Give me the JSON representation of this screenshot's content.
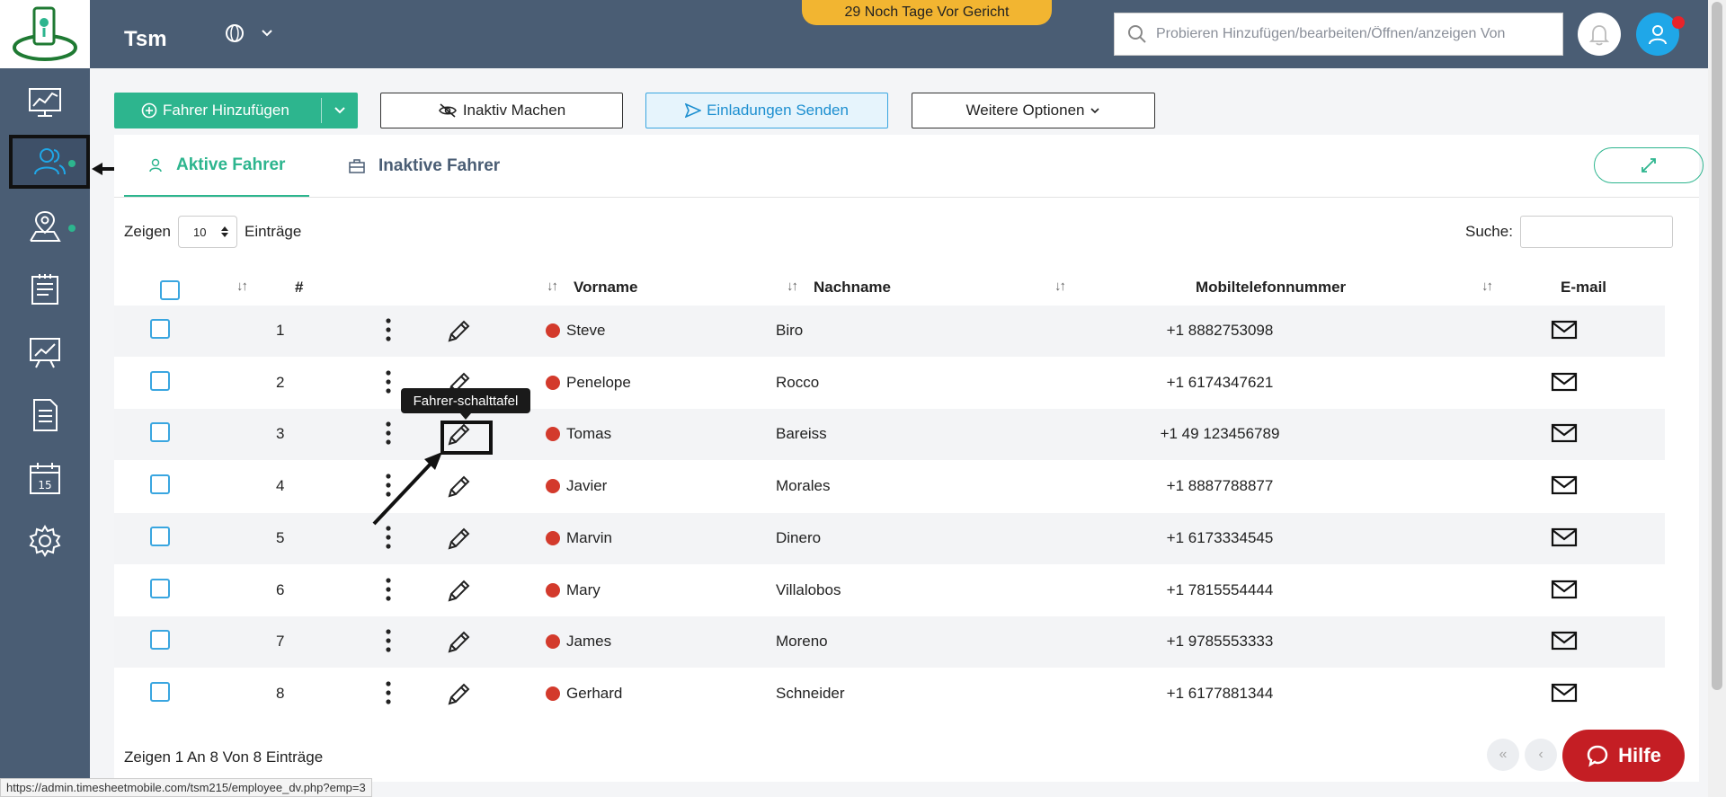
{
  "app": {
    "brand": "Tsm",
    "trial_notice": "29 Noch Tage Vor Gericht"
  },
  "header": {
    "search_placeholder": "Probieren Hinzufügen/bearbeiten/Öffnen/anzeigen Von"
  },
  "toolbar": {
    "add_driver": "Fahrer Hinzufügen",
    "deactivate": "Inaktiv Machen",
    "send_invites": "Einladungen Senden",
    "more_options": "Weitere Optionen"
  },
  "tabs": {
    "active": "Aktive Fahrer",
    "inactive": "Inaktive Fahrer"
  },
  "list_controls": {
    "show_label": "Zeigen",
    "page_size": "10",
    "entries_label": "Einträge",
    "search_label": "Suche:"
  },
  "table": {
    "headers": {
      "index": "#",
      "first_name": "Vorname",
      "last_name": "Nachname",
      "mobile": "Mobiltelefonnummer",
      "email": "E-mail"
    },
    "rows": [
      {
        "index": "1",
        "first_name": "Steve",
        "last_name": "Biro",
        "mobile": "+1 8882753098"
      },
      {
        "index": "2",
        "first_name": "Penelope",
        "last_name": "Rocco",
        "mobile": "+1 6174347621"
      },
      {
        "index": "3",
        "first_name": "Tomas",
        "last_name": "Bareiss",
        "mobile": "+1 49 123456789"
      },
      {
        "index": "4",
        "first_name": "Javier",
        "last_name": "Morales",
        "mobile": "+1 8887788877"
      },
      {
        "index": "5",
        "first_name": "Marvin",
        "last_name": "Dinero",
        "mobile": "+1 6173334545"
      },
      {
        "index": "6",
        "first_name": "Mary",
        "last_name": "Villalobos",
        "mobile": "+1 7815554444"
      },
      {
        "index": "7",
        "first_name": "James",
        "last_name": "Moreno",
        "mobile": "+1 9785553333"
      },
      {
        "index": "8",
        "first_name": "Gerhard",
        "last_name": "Schneider",
        "mobile": "+1 6177881344"
      }
    ]
  },
  "tooltip": "Fahrer-schalttafel",
  "footer": {
    "info": "Zeigen 1 An 8 Von 8 Einträge",
    "help": "Hilfe"
  },
  "status_bar_url": "https://admin.timesheetmobile.com/tsm215/employee_dv.php?emp=3",
  "colors": {
    "sidebar": "#4a5d74",
    "accent_green": "#2db58e",
    "accent_blue": "#1fa7e8",
    "badge_yellow": "#f2b531",
    "status_red": "#d33a2c",
    "help_red": "#c41e24"
  }
}
